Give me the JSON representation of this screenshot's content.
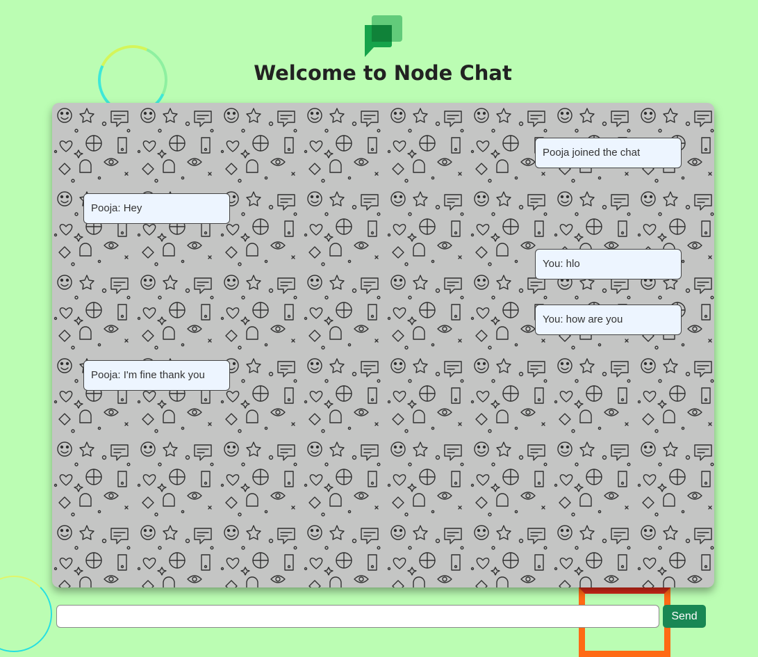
{
  "header": {
    "title": "Welcome to Node Chat",
    "logo_icon": "chat-logo-icon"
  },
  "colors": {
    "page_background": "#bbfdb3",
    "chat_background": "#c4c5c4",
    "message_bubble": "#edf5ff",
    "send_button": "#198754",
    "logo_green": "#1aa34a"
  },
  "chat": {
    "messages": [
      {
        "side": "right",
        "text": "Pooja joined the chat"
      },
      {
        "side": "left",
        "text": "Pooja: Hey"
      },
      {
        "side": "right",
        "text": "You: hlo"
      },
      {
        "side": "right",
        "text": "You: how are you"
      },
      {
        "side": "left",
        "text": "Pooja: I'm fine thank you"
      }
    ]
  },
  "composer": {
    "input_value": "",
    "input_placeholder": "",
    "send_label": "Send"
  }
}
